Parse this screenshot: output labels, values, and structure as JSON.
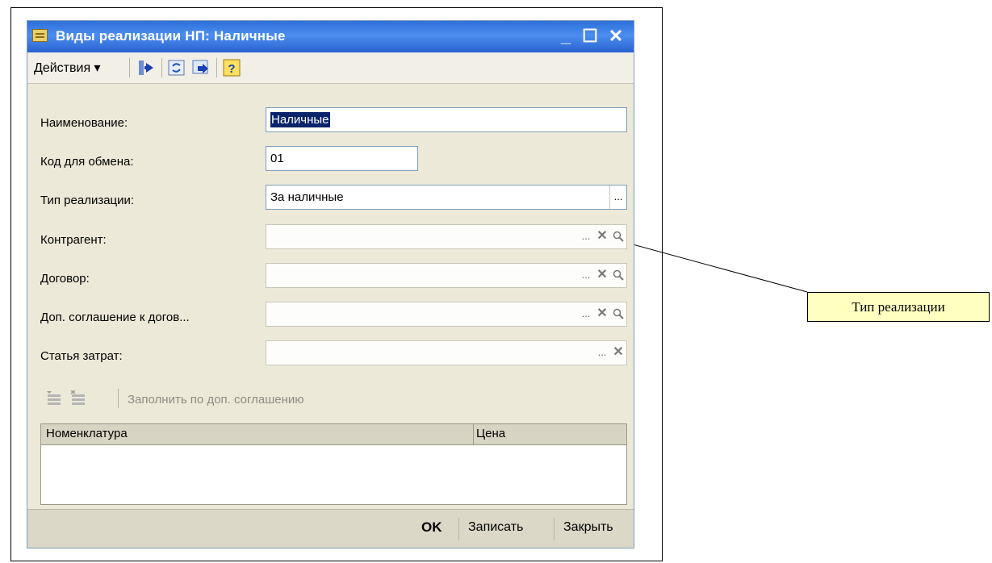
{
  "window": {
    "title": "Виды реализации НП: Наличные",
    "minimize_glyph": "_",
    "maximize_glyph": "☐",
    "close_glyph": "✕"
  },
  "toolbar": {
    "actions_label": "Действия ▾",
    "help_glyph": "?"
  },
  "form": {
    "name_label": "Наименование:",
    "name_value": "Наличные",
    "code_label": "Код для обмена:",
    "code_value": "01",
    "type_label": "Тип реализации:",
    "type_value": "За наличные",
    "counterparty_label": "Контрагент:",
    "contract_label": "Договор:",
    "addendum_label": "Доп. соглашение к догов...",
    "expense_label": "Статья затрат:",
    "dots_glyph": "...",
    "clear_glyph": "✕"
  },
  "items": {
    "fill_label": "Заполнить по доп. соглашению",
    "columns": [
      "Номенклатура",
      "Цена"
    ]
  },
  "footer": {
    "ok_label": "OK",
    "save_label": "Записать",
    "close_label": "Закрыть"
  },
  "callout": {
    "text": "Тип реализации"
  }
}
